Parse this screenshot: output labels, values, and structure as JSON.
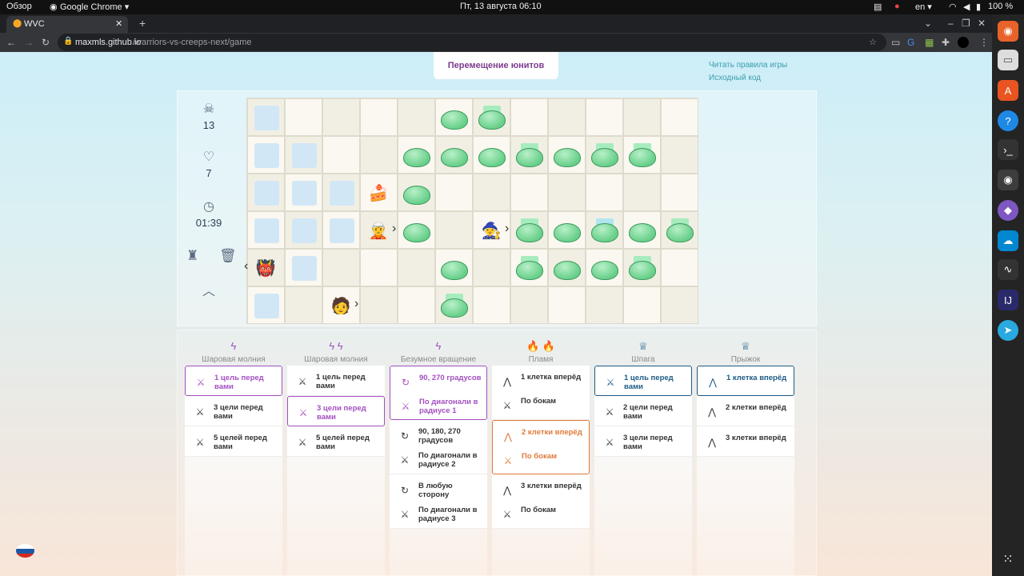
{
  "topbar": {
    "overview": "Обзор",
    "app": "Google Chrome ▾",
    "datetime": "Пт, 13 августа  06:10",
    "lang": "en ▾",
    "battery": "100 %"
  },
  "browser": {
    "tab_title": "WVC",
    "url_domain": "maxmls.github.io",
    "url_path": "/warriors-vs-creeps-next/game"
  },
  "dock_icons": [
    "firefox-icon",
    "files-icon",
    "software-icon",
    "help-icon",
    "terminal-icon",
    "chrome-icon",
    "github-icon",
    "cloud-icon",
    "monitor-icon",
    "intellij-icon",
    "telegram-icon",
    "apps-grid-icon"
  ],
  "header": {
    "mode_label": "Перемещение юнитов",
    "rules_link": "Читать правила игры",
    "source_link": "Исходный код"
  },
  "stats": {
    "kills": "13",
    "lives": "7",
    "timer": "01:39"
  },
  "colors": {
    "accent_purple": "#a34fc0",
    "accent_blue": "#1c5a86",
    "accent_orange": "#e07a3a",
    "slime": "#68cf8a",
    "spawn_square": "#d2e7f6"
  },
  "board": {
    "rows": 6,
    "cols": 12,
    "spawn_squares": [
      [
        0,
        0
      ],
      [
        1,
        0
      ],
      [
        1,
        1
      ],
      [
        2,
        0
      ],
      [
        2,
        1
      ],
      [
        2,
        2
      ],
      [
        3,
        0
      ],
      [
        3,
        1
      ],
      [
        3,
        2
      ],
      [
        4,
        1
      ],
      [
        5,
        0
      ]
    ],
    "slimes": [
      [
        0,
        5
      ],
      [
        0,
        6
      ],
      [
        1,
        4
      ],
      [
        1,
        5
      ],
      [
        1,
        6
      ],
      [
        1,
        7
      ],
      [
        1,
        8
      ],
      [
        1,
        9
      ],
      [
        1,
        10
      ],
      [
        2,
        4
      ],
      [
        3,
        4
      ],
      [
        3,
        7
      ],
      [
        3,
        8
      ],
      [
        3,
        9
      ],
      [
        3,
        10
      ],
      [
        3,
        11
      ],
      [
        4,
        5
      ],
      [
        4,
        7
      ],
      [
        4,
        8
      ],
      [
        4,
        9
      ],
      [
        4,
        10
      ],
      [
        5,
        5
      ]
    ],
    "highlights": [
      [
        0,
        6
      ],
      [
        1,
        7
      ],
      [
        1,
        9
      ],
      [
        1,
        10
      ],
      [
        3,
        7
      ],
      [
        3,
        11
      ],
      [
        4,
        7
      ],
      [
        4,
        10
      ],
      [
        5,
        5
      ]
    ],
    "highlights_blue": [
      [
        3,
        9
      ]
    ],
    "units": [
      {
        "name": "cake",
        "row": 2,
        "col": 3,
        "glyph": "🍰",
        "arrow": ""
      },
      {
        "name": "blue-warrior",
        "row": 3,
        "col": 3,
        "glyph": "🧝",
        "arrow": "›"
      },
      {
        "name": "dark-warrior",
        "row": 3,
        "col": 6,
        "glyph": "🧙",
        "arrow": "›"
      },
      {
        "name": "red-warrior",
        "row": 4,
        "col": 0,
        "glyph": "👹",
        "arrow": "‹"
      },
      {
        "name": "blonde-warrior",
        "row": 5,
        "col": 2,
        "glyph": "🧑",
        "arrow": "›"
      }
    ]
  },
  "columns": [
    {
      "title": "Шаровая молния",
      "icon": "ϟ",
      "color": "purple",
      "cards": [
        {
          "selected": true,
          "options": [
            {
              "icon": "sword",
              "text": "1 цель перед вами"
            }
          ]
        },
        {
          "selected": false,
          "options": [
            {
              "icon": "sword",
              "text": "3 цели перед вами"
            }
          ]
        },
        {
          "selected": false,
          "options": [
            {
              "icon": "sword",
              "text": "5 целей перед вами"
            }
          ]
        }
      ]
    },
    {
      "title": "Шаровая молния",
      "icon": "ϟ ϟ",
      "color": "purple",
      "cards": [
        {
          "selected": false,
          "options": [
            {
              "icon": "sword",
              "text": "1 цель перед вами"
            }
          ]
        },
        {
          "selected": true,
          "options": [
            {
              "icon": "sword",
              "text": "3 цели перед вами"
            }
          ]
        },
        {
          "selected": false,
          "options": [
            {
              "icon": "sword",
              "text": "5 целей перед вами"
            }
          ]
        }
      ]
    },
    {
      "title": "Безумное вращение",
      "icon": "ϟ",
      "color": "purple",
      "cards": [
        {
          "selected": true,
          "options": [
            {
              "icon": "rotate",
              "text": "90, 270 градусов"
            },
            {
              "icon": "sword",
              "text": "По диагонали в радиусе 1"
            }
          ]
        },
        {
          "selected": false,
          "options": [
            {
              "icon": "rotate",
              "text": "90, 180, 270 градусов"
            },
            {
              "icon": "sword",
              "text": "По диагонали в радиусе 2"
            }
          ]
        },
        {
          "selected": false,
          "options": [
            {
              "icon": "rotate",
              "text": "В любую сторону"
            },
            {
              "icon": "sword",
              "text": "По диагонали в радиусе 3"
            }
          ]
        }
      ]
    },
    {
      "title": "Пламя",
      "icon": "🔥 🔥",
      "color": "orange",
      "cards": [
        {
          "selected": false,
          "options": [
            {
              "icon": "move",
              "text": "1 клетка вперёд"
            },
            {
              "icon": "sword",
              "text": "По бокам"
            }
          ]
        },
        {
          "selected": true,
          "options": [
            {
              "icon": "move",
              "text": "2 клетки вперёд"
            },
            {
              "icon": "sword",
              "text": "По бокам"
            }
          ]
        },
        {
          "selected": false,
          "options": [
            {
              "icon": "move",
              "text": "3 клетки вперёд"
            },
            {
              "icon": "sword",
              "text": "По бокам"
            }
          ]
        }
      ]
    },
    {
      "title": "Шпага",
      "icon": "♕",
      "color": "blue",
      "cards": [
        {
          "selected": true,
          "options": [
            {
              "icon": "sword",
              "text": "1 цель перед вами"
            }
          ]
        },
        {
          "selected": false,
          "options": [
            {
              "icon": "sword",
              "text": "2 цели перед вами"
            }
          ]
        },
        {
          "selected": false,
          "options": [
            {
              "icon": "sword",
              "text": "3 цели перед вами"
            }
          ]
        }
      ]
    },
    {
      "title": "Прыжок",
      "icon": "♕",
      "color": "blue",
      "cards": [
        {
          "selected": true,
          "options": [
            {
              "icon": "move",
              "text": "1 клетка вперёд"
            }
          ]
        },
        {
          "selected": false,
          "options": [
            {
              "icon": "move",
              "text": "2 клетки вперёд"
            }
          ]
        },
        {
          "selected": false,
          "options": [
            {
              "icon": "move",
              "text": "3 клетки вперёд"
            }
          ]
        }
      ]
    }
  ]
}
